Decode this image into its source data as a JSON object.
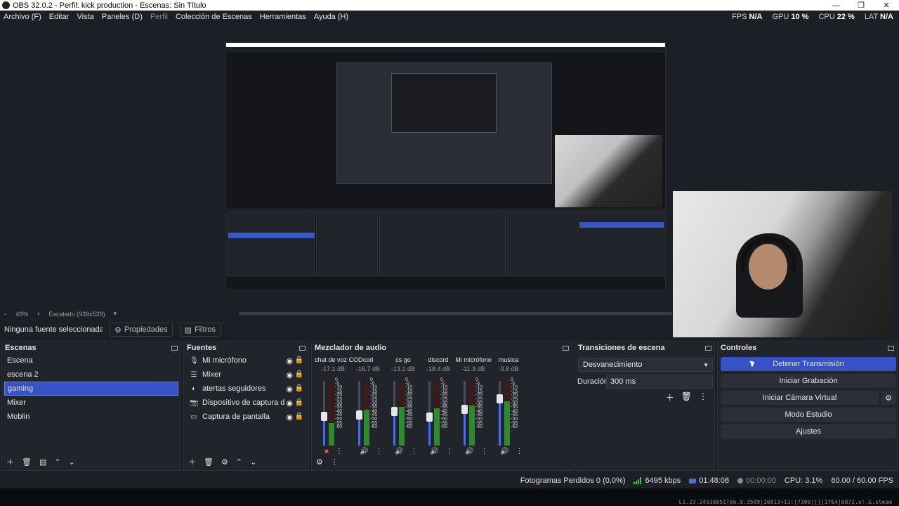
{
  "window": {
    "title": "OBS 32.0.2 - Perfil: kick production - Escenas: Sin Título"
  },
  "menu": [
    {
      "label": "Archivo (F)",
      "enabled": true
    },
    {
      "label": "Editar",
      "enabled": true
    },
    {
      "label": "Vista",
      "enabled": true
    },
    {
      "label": "Paneles (D)",
      "enabled": true
    },
    {
      "label": "Perfil",
      "enabled": false
    },
    {
      "label": "Colección de Escenas",
      "enabled": true
    },
    {
      "label": "Herramientas",
      "enabled": true
    },
    {
      "label": "Ayuda (H)",
      "enabled": true
    }
  ],
  "stats": {
    "fps_label": "FPS",
    "fps_value": "N/A",
    "gpu_label": "GPU",
    "gpu_value": "10 %",
    "cpu_label": "CPU",
    "cpu_value": "22 %",
    "lat_label": "LAT",
    "lat_value": "N/A"
  },
  "preview_bar": {
    "zoom_out": "−",
    "zoom": "48%",
    "zoom_in": "+",
    "scale": "Escalado (939x528)"
  },
  "source_toolbar": {
    "no_source": "Ninguna fuente seleccionada",
    "properties": "Propiedades",
    "filters": "Filtros"
  },
  "scenes": {
    "title": "Escenas",
    "items": [
      "Escena",
      "escena 2",
      "gaming",
      "Mixer",
      "Moblin"
    ],
    "active_index": 2
  },
  "sources": {
    "title": "Fuentes",
    "items": [
      {
        "label": "Mi micrófono",
        "icon": "microphone-icon"
      },
      {
        "label": "Mixer",
        "icon": "list-icon"
      },
      {
        "label": "atertas seguidores",
        "icon": "browser-icon"
      },
      {
        "label": "Dispositivo de captura de video",
        "icon": "camera-icon"
      },
      {
        "label": "Captura de pantalla",
        "icon": "monitor-icon"
      }
    ]
  },
  "mixer": {
    "title": "Mezclador de audio",
    "scale": [
      "0",
      "-5",
      "-10",
      "-15",
      "-20",
      "-25",
      "-30",
      "-35",
      "-40",
      "-45",
      "-50",
      "-55",
      "-60"
    ],
    "channels": [
      {
        "name": "chat de voz COD",
        "db": "-17.1 dB",
        "muted": true,
        "fader": 0.45,
        "level": 0.35
      },
      {
        "name": "cod",
        "db": "-16.7 dB",
        "muted": false,
        "fader": 0.47,
        "level": 0.55
      },
      {
        "name": "cs go",
        "db": "-13.1 dB",
        "muted": false,
        "fader": 0.52,
        "level": 0.6
      },
      {
        "name": "discord",
        "db": "-18.4 dB",
        "muted": false,
        "fader": 0.44,
        "level": 0.58
      },
      {
        "name": "Mi micrófono",
        "db": "-11.3 dB",
        "muted": false,
        "fader": 0.55,
        "level": 0.62
      },
      {
        "name": "musica",
        "db": "-3.8 dB",
        "muted": false,
        "fader": 0.72,
        "level": 0.68
      }
    ]
  },
  "transitions": {
    "title": "Transiciones de escena",
    "selected": "Desvanecimiento",
    "duration_label": "Duración",
    "duration_value": "300 ms"
  },
  "controls": {
    "title": "Controles",
    "stop_stream": "Detener Transmisión",
    "start_record": "Iniciar Grabación",
    "start_vcam": "Iniciar Cámara Virtual",
    "studio_mode": "Modo Estudio",
    "settings": "Ajustes"
  },
  "status": {
    "dropped_frames": "Fotogramas Perdidos 0 (0,0%)",
    "bitrate": "6495 kbps",
    "live_time": "01:48:08",
    "rec_time": "00:00:00",
    "cpu": "CPU: 3.1%",
    "fps": "60.00 / 60.00 FPS"
  },
  "footer_text": "L1.23.24536851[66.0.3509]10813+11:[7300][][1764]0872.o!.G.steam",
  "colors": {
    "accent": "#3652c6",
    "bg": "#1d1f26",
    "dock": "#22242b",
    "meter_green": "#2f8a2f"
  }
}
